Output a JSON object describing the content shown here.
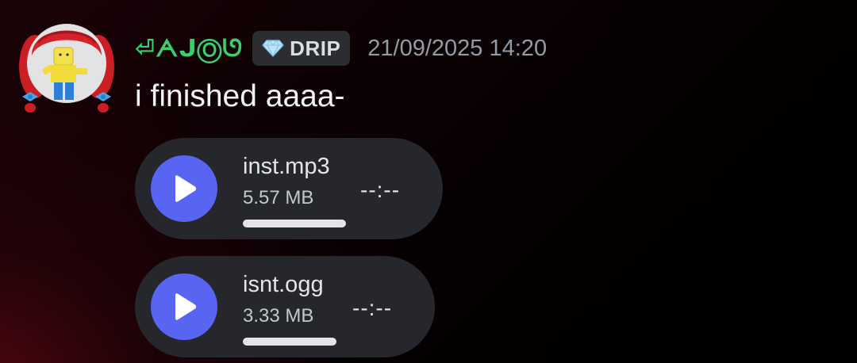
{
  "message": {
    "author": {
      "display_name": "⏎ᗅᒍⓄᘎ",
      "name_color": "#3ccf6b"
    },
    "tag": {
      "icon": "diamond-icon",
      "label": "DRIP"
    },
    "timestamp": "21/09/2025 14:20",
    "text": "i finished aaaa-",
    "attachments": [
      {
        "filename": "inst.mp3",
        "size": "5.57 MB",
        "duration": "--:--",
        "play_icon": "play-icon",
        "progress": 0
      },
      {
        "filename": "isnt.ogg",
        "size": "3.33 MB",
        "duration": "--:--",
        "play_icon": "play-icon",
        "progress": 0
      }
    ]
  },
  "colors": {
    "accent": "#5865f2",
    "card_background": "#26272c",
    "timestamp": "#949ba4"
  }
}
